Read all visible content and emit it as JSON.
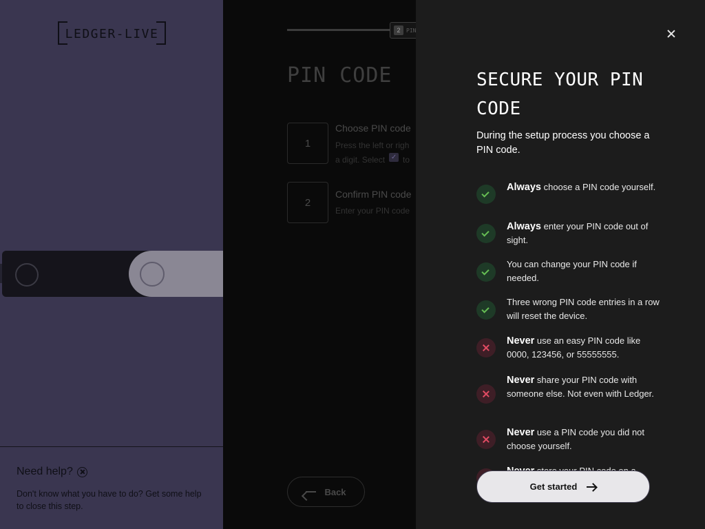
{
  "app": {
    "logo_text": "LEDGER-LIVE"
  },
  "help": {
    "title": "Need help?",
    "text": "Don't know what you have to do? Get some help to close this step."
  },
  "steps_page": {
    "progress_step_num": "2",
    "progress_step_label": "PIN",
    "progress_fraction": 0.95,
    "title": "PIN CODE",
    "steps": [
      {
        "num": "1",
        "title": "Choose PIN code",
        "desc_line1": "Press the left or righ",
        "desc_line2_pre": "a digit. Select",
        "desc_line2_post": "to"
      },
      {
        "num": "2",
        "title": "Confirm PIN code",
        "desc_line1": "Enter your PIN code"
      }
    ],
    "back_label": "Back"
  },
  "drawer": {
    "title": "SECURE YOUR PIN CODE",
    "intro": "During the setup process you choose a PIN code.",
    "rules": [
      {
        "kind": "ok",
        "strong": "Always",
        "text": " choose a PIN code yourself."
      },
      {
        "kind": "ok",
        "strong": "Always",
        "text": " enter your PIN code out of sight."
      },
      {
        "kind": "ok",
        "strong": "",
        "text": "You can change your PIN code if needed."
      },
      {
        "kind": "ok",
        "strong": "",
        "text": "Three wrong PIN code entries in a row will reset the device."
      },
      {
        "kind": "no",
        "strong": "Never",
        "text": " use an easy PIN code like 0000, 123456, or 55555555."
      },
      {
        "kind": "no",
        "strong": "Never",
        "text": " share your PIN code with someone else. Not even with Ledger."
      },
      {
        "kind": "no",
        "strong": "Never",
        "text": " use a PIN code you did not choose yourself."
      },
      {
        "kind": "no",
        "strong": "Never",
        "text": " store your PIN code on a"
      }
    ],
    "start_label": "Get started"
  }
}
